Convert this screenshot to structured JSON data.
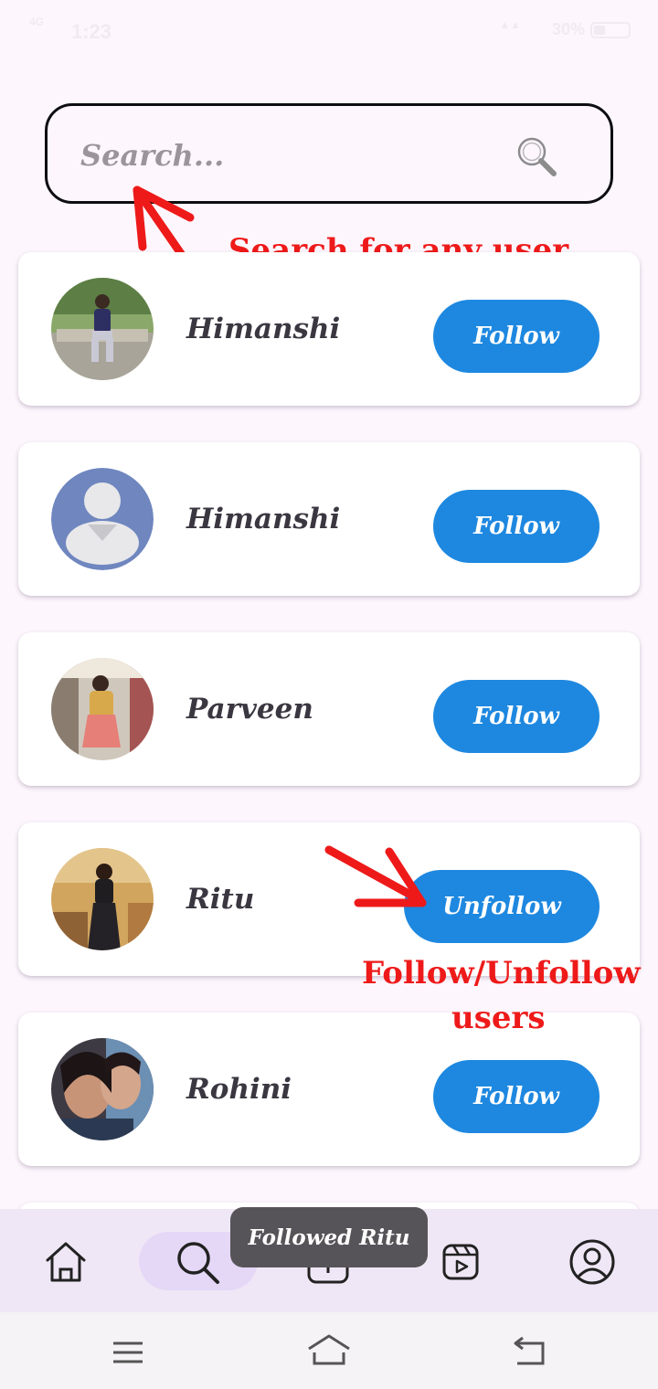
{
  "status_bar": {
    "left_signal": "4G",
    "time": "1:23",
    "battery": "30%"
  },
  "search": {
    "placeholder": "Search...",
    "value": ""
  },
  "annotations": {
    "search_hint": "Search for any user",
    "follow_hint_line1": "Follow/Unfollow",
    "follow_hint_line2": "users"
  },
  "users": [
    {
      "name": "Himanshi",
      "button": "Follow",
      "avatar": "photo"
    },
    {
      "name": "Himanshi",
      "button": "Follow",
      "avatar": "default-avatar"
    },
    {
      "name": "Parveen",
      "button": "Follow",
      "avatar": "photo"
    },
    {
      "name": "Ritu",
      "button": "Unfollow",
      "avatar": "photo"
    },
    {
      "name": "Rohini",
      "button": "Follow",
      "avatar": "photo"
    }
  ],
  "toast": "Followed Ritu",
  "bottom_nav": {
    "items": [
      "home-icon",
      "search-icon",
      "add-post-icon",
      "reels-icon",
      "profile-icon"
    ],
    "active": "search-icon"
  },
  "colors": {
    "accent": "#1e88e0",
    "annotation": "#ee1a1a",
    "background": "#fdf6fd",
    "nav_background": "#efe7f5",
    "active_pill": "#e5d8f7"
  }
}
